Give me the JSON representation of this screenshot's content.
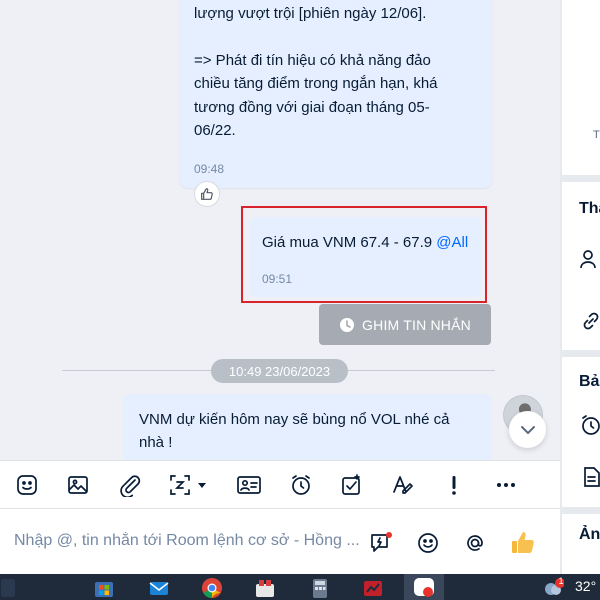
{
  "messages": {
    "msg1": {
      "lines": [
        "lượng vượt trội [phiên ngày 12/06].",
        "",
        "=> Phát đi tín hiệu có khả năng đảo",
        "chiều tăng điểm trong ngắn hạn, khá",
        "tương đồng với giai đoạn tháng 05-",
        "06/22."
      ],
      "time": "09:48"
    },
    "msg2": {
      "text": "Giá mua VNM 67.4 - 67.9 ",
      "mention": "@All",
      "time": "09:51"
    },
    "msg3": {
      "line1": "VNM dự kiến hôm nay sẽ bùng nổ VOL nhé cả",
      "line2": "nhà !"
    }
  },
  "pin_button": {
    "label": "GHIM TIN NHẮN"
  },
  "date_separator": "10:49 23/06/2023",
  "input": {
    "placeholder": "Nhập @, tin nhắn tới Room lệnh cơ sở - Hồng ..."
  },
  "right_panel": {
    "top_letter": "T",
    "section1_title": "Tha",
    "section2_title": "Bả",
    "section3_title": "Ản"
  },
  "taskbar": {
    "temperature": "32°",
    "weather_badge": "1"
  },
  "icons": {
    "toolbar": [
      "sticker-icon",
      "image-icon",
      "attachment-icon",
      "screenshot-icon",
      "dropdown-caret-icon",
      "contact-card-icon",
      "alarm-icon",
      "todo-icon",
      "format-text-icon",
      "important-icon",
      "more-icon"
    ],
    "input": [
      "quick-message-icon",
      "emoji-icon",
      "mention-icon",
      "thumbs-up-icon"
    ]
  },
  "colors": {
    "bubble": "#e5efff",
    "mention": "#0068ff",
    "highlight_border": "#d8232a",
    "pin_button": "#a6abb3",
    "taskbar": "#1f2a3a"
  }
}
